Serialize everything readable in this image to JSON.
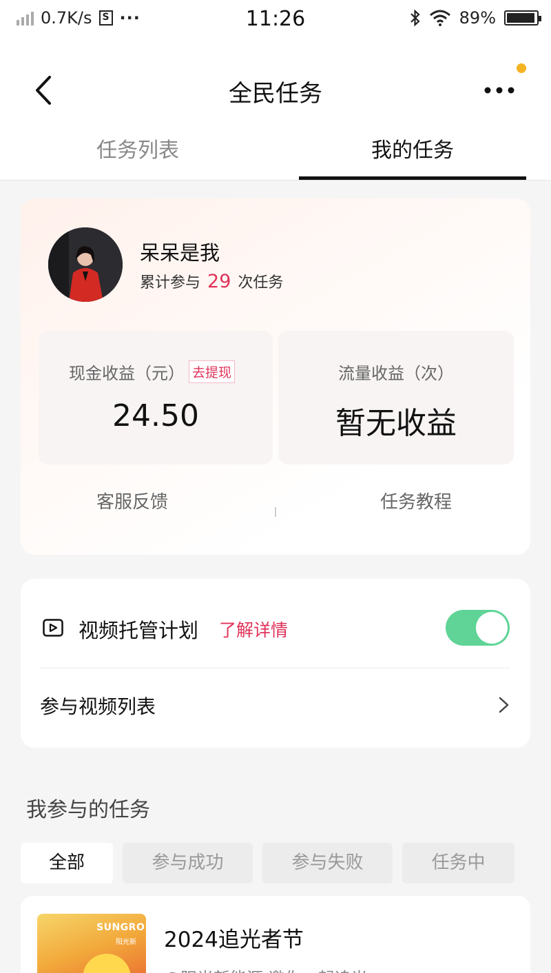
{
  "status_bar": {
    "speed": "0.7K/s",
    "s_icon_label": "S",
    "dots": "···",
    "time": "11:26",
    "battery": "89%"
  },
  "nav": {
    "title": "全民任务",
    "notify_color": "#f5b323"
  },
  "tabs": [
    {
      "label": "任务列表",
      "active": false
    },
    {
      "label": "我的任务",
      "active": true
    }
  ],
  "profile": {
    "name": "呆呆是我",
    "count_prefix": "累计参与",
    "count": "29",
    "count_suffix": "次任务",
    "cash_label": "现金收益（元）",
    "withdraw_label": "去提现",
    "cash_value": "24.50",
    "flow_label": "流量收益（次）",
    "flow_value": "暂无收益",
    "service_label": "客服反馈",
    "tutorial_label": "任务教程"
  },
  "plan": {
    "icon": "video-play-icon",
    "title": "视频托管计划",
    "detail_link": "了解详情",
    "toggle_on": true,
    "list_label": "参与视频列表"
  },
  "my_tasks": {
    "title": "我参与的任务",
    "filters": [
      {
        "label": "全部",
        "active": true
      },
      {
        "label": "参与成功",
        "active": false
      },
      {
        "label": "参与失败",
        "active": false
      },
      {
        "label": "任务中",
        "active": false
      }
    ],
    "items": [
      {
        "thumb_brand": "SUNGRO",
        "thumb_sub": "阳光新",
        "title": "2024追光者节",
        "subtitle": "@阳光新能源 邀你一起追光"
      }
    ]
  },
  "colors": {
    "accent_pink": "#e0335a",
    "toggle_green": "#5fd496"
  }
}
